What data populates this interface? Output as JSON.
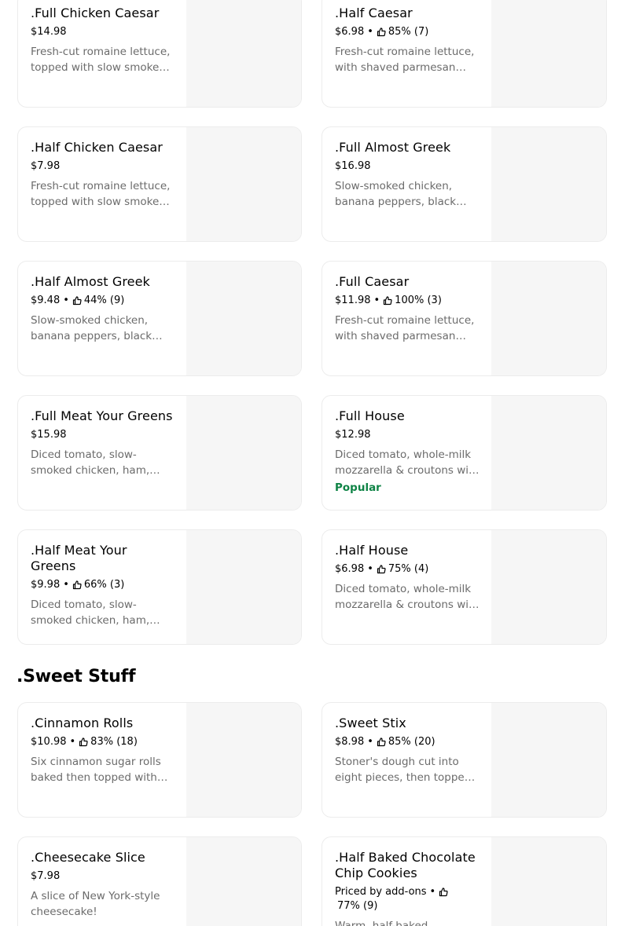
{
  "salads": [
    {
      "name": ".Full Chicken Caesar",
      "price": "$14.98",
      "rating": "",
      "description": "Fresh-cut romaine lettuce, topped with slow smoked chicken, shaved parmesan",
      "badge": ""
    },
    {
      "name": ".Half Caesar",
      "price": "$6.98",
      "rating": "85% (7)",
      "description": "Fresh-cut romaine lettuce, with shaved parmesan cheese and croutons",
      "badge": ""
    },
    {
      "name": ".Half Chicken Caesar",
      "price": "$7.98",
      "rating": "",
      "description": "Fresh-cut romaine lettuce, topped with slow smoked chicken, shaved parmesan",
      "badge": ""
    },
    {
      "name": ".Full Almost Greek",
      "price": "$16.98",
      "rating": "",
      "description": "Slow-smoked chicken, banana peppers, black olives, red onion",
      "badge": ""
    },
    {
      "name": ".Half Almost Greek",
      "price": "$9.48",
      "rating": "44% (9)",
      "description": "Slow-smoked chicken, banana peppers, black olives, red onion",
      "badge": ""
    },
    {
      "name": ".Full Caesar",
      "price": "$11.98",
      "rating": "100% (3)",
      "description": "Fresh-cut romaine lettuce, with shaved parmesan cheese and croutons",
      "badge": ""
    },
    {
      "name": ".Full Meat Your Greens",
      "price": "$15.98",
      "rating": "",
      "description": "Diced tomato, slow-smoked chicken, ham, crispy bacon, cheddar cheese",
      "badge": ""
    },
    {
      "name": ".Full House",
      "price": "$12.98",
      "rating": "",
      "description": "Diced tomato, whole-milk mozzarella & croutons with your choice of dressing",
      "badge": "Popular"
    },
    {
      "name": ".Half Meat Your Greens",
      "price": "$9.98",
      "rating": "66% (3)",
      "description": "Diced tomato, slow-smoked chicken, ham, crispy bacon, cheddar cheese",
      "badge": ""
    },
    {
      "name": ".Half House",
      "price": "$6.98",
      "rating": "75% (4)",
      "description": "Diced tomato, whole-milk mozzarella & croutons with your choice of dressing",
      "badge": ""
    }
  ],
  "sweet_section": {
    "heading": ".Sweet Stuff",
    "items": [
      {
        "name": ".Cinnamon Rolls",
        "price": "$10.98",
        "rating": "83% (18)",
        "description": "Six cinnamon sugar rolls baked then topped with icing",
        "badge": ""
      },
      {
        "name": ".Sweet Stix",
        "price": "$8.98",
        "rating": "85% (20)",
        "description": "Stoner's dough cut into eight pieces, then topped with cinnamon sugar",
        "badge": ""
      },
      {
        "name": ".Cheesecake Slice",
        "price": "$7.98",
        "rating": "",
        "description": "A slice of New York-style cheesecake!",
        "badge": ""
      },
      {
        "name": ".Half Baked Chocolate Chip Cookies",
        "price": "Priced by add-ons",
        "rating": "77% (9)",
        "description": "Warm, half-baked chocolate chip cookies",
        "badge": "",
        "wrap_rating": true
      }
    ]
  },
  "colors": {
    "popular": "#0e8345",
    "muted_text": "#6b6b6b",
    "card_border": "#ececec",
    "thumb_bg": "#f6f6f6"
  },
  "icons": {
    "rating": "thumbs-up-icon"
  }
}
